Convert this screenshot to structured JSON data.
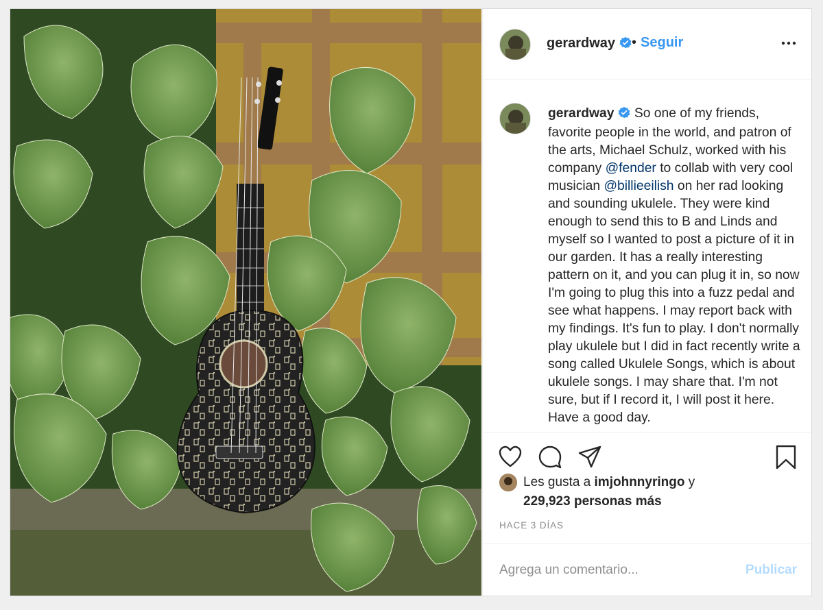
{
  "post": {
    "username": "gerardway",
    "separator": "•",
    "follow_label": "Seguir",
    "caption_parts": [
      "So one of my friends, favorite people in the world, and patron of the arts, Michael Schulz, worked with his company ",
      "@fender",
      " to collab with very cool musician ",
      "@billieeilish",
      " on her rad looking and sounding ukulele. They were kind enough to send this to B and Linds and myself so I wanted to post a picture of it in our garden. It has a really interesting pattern on it, and you can plug it in, so now I'm going to plug this into a fuzz pedal and see what happens. I may report back with my findings. It's fun to play. I don't normally play ukulele but I did in fact recently write a song called Ukulele Songs, which is about ukulele songs. I may share that. I'm not sure, but if I record it, I will post it here. Have a good day."
    ],
    "likes_prefix": "Les gusta a",
    "likes_user": "imjohnnyringo",
    "likes_conj": "y",
    "likes_count": "229,923 personas más",
    "timestamp": "HACE 3 DÍAS",
    "comment_placeholder": "Agrega un comentario...",
    "publish_label": "Publicar"
  },
  "colors": {
    "accent": "#3897f0",
    "mention": "#003569",
    "muted": "#8e8e8e",
    "publish_disabled": "#b3dbff"
  },
  "icons": {
    "verified": "verified-badge-icon",
    "more": "more-options-icon",
    "like": "heart-icon",
    "comment": "comment-bubble-icon",
    "share": "paper-plane-icon",
    "save": "bookmark-icon"
  }
}
